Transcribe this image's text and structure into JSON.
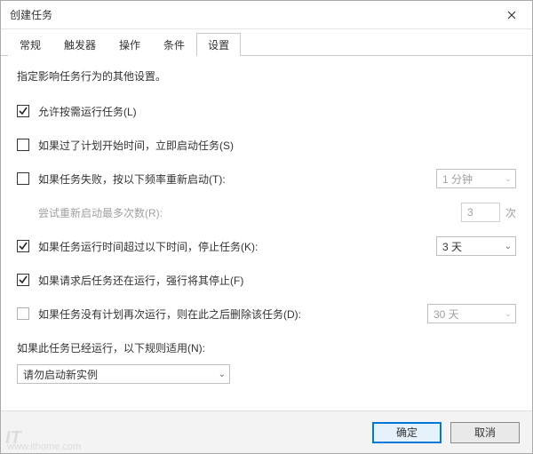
{
  "window": {
    "title": "创建任务"
  },
  "tabs": {
    "items": [
      "常规",
      "触发器",
      "操作",
      "条件",
      "设置"
    ],
    "active_index": 4
  },
  "desc": "指定影响任务行为的其他设置。",
  "rows": {
    "allow_on_demand": {
      "checked": true,
      "label": "允许按需运行任务(L)"
    },
    "run_if_missed": {
      "checked": false,
      "label": "如果过了计划开始时间，立即启动任务(S)"
    },
    "restart_on_fail": {
      "checked": false,
      "label": "如果任务失败，按以下频率重新启动(T):",
      "interval_value": "1 分钟"
    },
    "restart_attempts": {
      "label": "尝试重新启动最多次数(R):",
      "value": "3",
      "suffix": "次"
    },
    "stop_if_long": {
      "checked": true,
      "label": "如果任务运行时间超过以下时间，停止任务(K):",
      "duration_value": "3 天"
    },
    "force_stop": {
      "checked": true,
      "label": "如果请求后任务还在运行，强行将其停止(F)"
    },
    "delete_if_not_scheduled": {
      "checked": false,
      "label": "如果任务没有计划再次运行，则在此之后删除该任务(D):",
      "delay_value": "30 天"
    },
    "rule_label": "如果此任务已经运行，以下规则适用(N):",
    "rule_value": "请勿启动新实例"
  },
  "footer": {
    "ok": "确定",
    "cancel": "取消"
  },
  "watermark": {
    "logo": "IT",
    "url": "www.ithome.com"
  }
}
